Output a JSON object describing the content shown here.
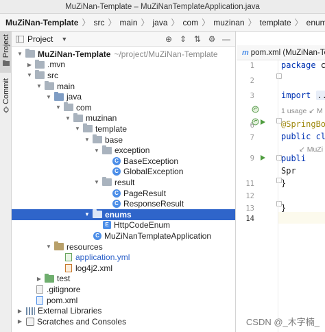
{
  "window": {
    "title": "MuZiNan-Template – MuZiNanTemplateApplication.java"
  },
  "breadcrumbs": [
    "MuZiNan-Template",
    "src",
    "main",
    "java",
    "com",
    "muzinan",
    "template",
    "enums"
  ],
  "left_stripe": {
    "project_label": "Project",
    "commit_label": "Commit"
  },
  "project_panel": {
    "title": "Project",
    "header_icons": [
      "target-icon",
      "collapse-icon",
      "expand-icon",
      "settings-icon",
      "minimize-icon"
    ]
  },
  "tree": [
    {
      "label": "MuZiNan-Template",
      "path": "~/project/MuZiNan-Template",
      "icon": "project-folder",
      "expanded": true,
      "bold": true
    },
    {
      "label": ".mvn",
      "icon": "folder",
      "expanded": false
    },
    {
      "label": "src",
      "icon": "folder",
      "expanded": true
    },
    {
      "label": "main",
      "icon": "folder",
      "expanded": true
    },
    {
      "label": "java",
      "icon": "source-folder",
      "expanded": true
    },
    {
      "label": "com",
      "icon": "package",
      "expanded": true
    },
    {
      "label": "muzinan",
      "icon": "package",
      "expanded": true
    },
    {
      "label": "template",
      "icon": "package",
      "expanded": true
    },
    {
      "label": "base",
      "icon": "package",
      "expanded": true
    },
    {
      "label": "exception",
      "icon": "package",
      "expanded": true
    },
    {
      "label": "BaseException",
      "icon": "class"
    },
    {
      "label": "GlobalException",
      "icon": "class"
    },
    {
      "label": "result",
      "icon": "package",
      "expanded": true
    },
    {
      "label": "PageResult",
      "icon": "class"
    },
    {
      "label": "ResponseResult",
      "icon": "class"
    },
    {
      "label": "enums",
      "icon": "package",
      "expanded": true,
      "selected": true
    },
    {
      "label": "HttpCodeEnum",
      "icon": "enum"
    },
    {
      "label": "MuZiNanTemplateApplication",
      "icon": "spring-class"
    },
    {
      "label": "resources",
      "icon": "resources-folder",
      "expanded": true
    },
    {
      "label": "application.yml",
      "icon": "yml-file",
      "link": true
    },
    {
      "label": "log4j2.xml",
      "icon": "xml-file"
    },
    {
      "label": "test",
      "icon": "test-folder",
      "expanded": false
    },
    {
      "label": ".gitignore",
      "icon": "git-file"
    },
    {
      "label": "pom.xml",
      "icon": "maven-file"
    },
    {
      "label": "External Libraries",
      "icon": "library",
      "expanded": false
    },
    {
      "label": "Scratches and Consoles",
      "icon": "scratch",
      "expanded": false
    }
  ],
  "editor": {
    "tab_label": "pom.xml (MuZiNan-Template)",
    "tab_icon": "m",
    "line_numbers": [
      "1",
      "2",
      "3",
      "",
      "6",
      "7",
      "",
      "9",
      "",
      "11",
      "12",
      "13",
      "14"
    ],
    "lines": [
      {
        "parts": [
          {
            "t": "package ",
            "c": "kw"
          },
          {
            "t": "co",
            "c": ""
          }
        ]
      },
      {
        "parts": []
      },
      {
        "parts": [
          {
            "t": "import ",
            "c": "kw"
          },
          {
            "t": "...",
            "c": "fold-dots"
          }
        ]
      },
      {
        "parts": [
          {
            "t": "1 usage  ",
            "c": "hint"
          },
          {
            "t": "↙ M",
            "c": "hint"
          }
        ]
      },
      {
        "parts": [
          {
            "t": "@SpringBoot",
            "c": "ann"
          }
        ]
      },
      {
        "parts": [
          {
            "t": "public ",
            "c": "kw"
          },
          {
            "t": "cla",
            "c": "kw"
          }
        ]
      },
      {
        "parts": [
          {
            "t": "↙ MuZi",
            "c": "hint"
          }
        ]
      },
      {
        "parts": [
          {
            "t": "    publi",
            "c": "kw"
          }
        ]
      },
      {
        "parts": [
          {
            "t": "        Spr",
            "c": ""
          }
        ]
      },
      {
        "parts": [
          {
            "t": "    }",
            "c": ""
          }
        ]
      },
      {
        "parts": []
      },
      {
        "parts": [
          {
            "t": "}",
            "c": ""
          }
        ]
      },
      {
        "parts": []
      }
    ]
  },
  "watermark": "CSDN @_木字楠_"
}
